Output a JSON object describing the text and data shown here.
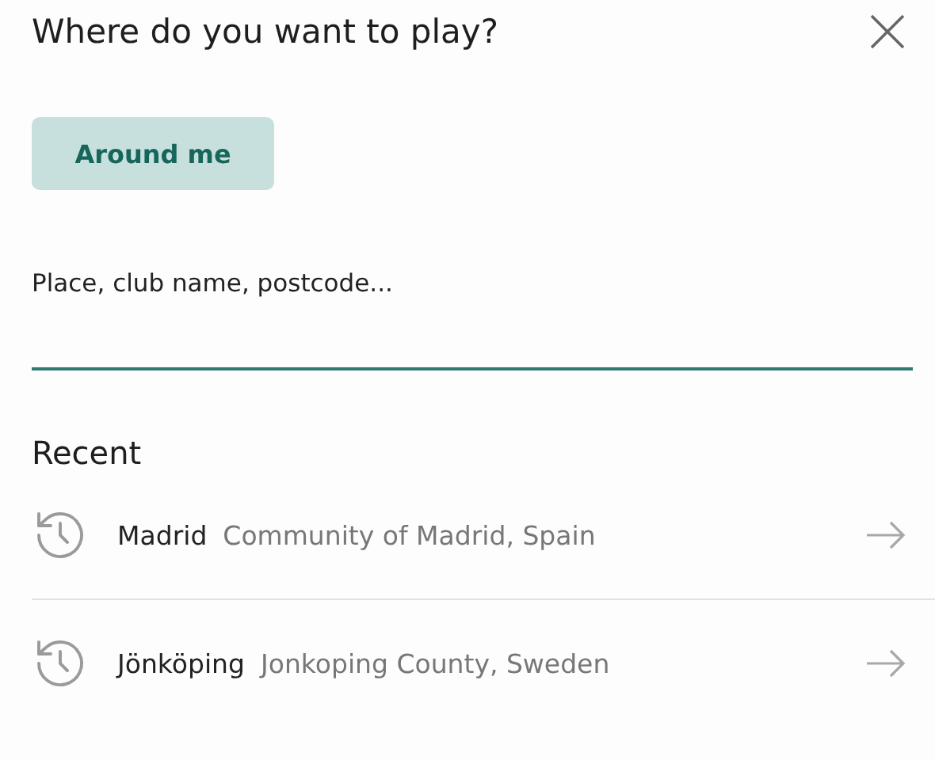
{
  "dialog": {
    "title": "Where do you want to play?"
  },
  "around_me_button": {
    "label": "Around me"
  },
  "search": {
    "label": "Place, club name, postcode..."
  },
  "recent": {
    "heading": "Recent",
    "items": [
      {
        "name": "Madrid",
        "region": "Community of Madrid, Spain"
      },
      {
        "name": "Jönköping",
        "region": "Jonkoping County, Sweden"
      }
    ]
  }
}
